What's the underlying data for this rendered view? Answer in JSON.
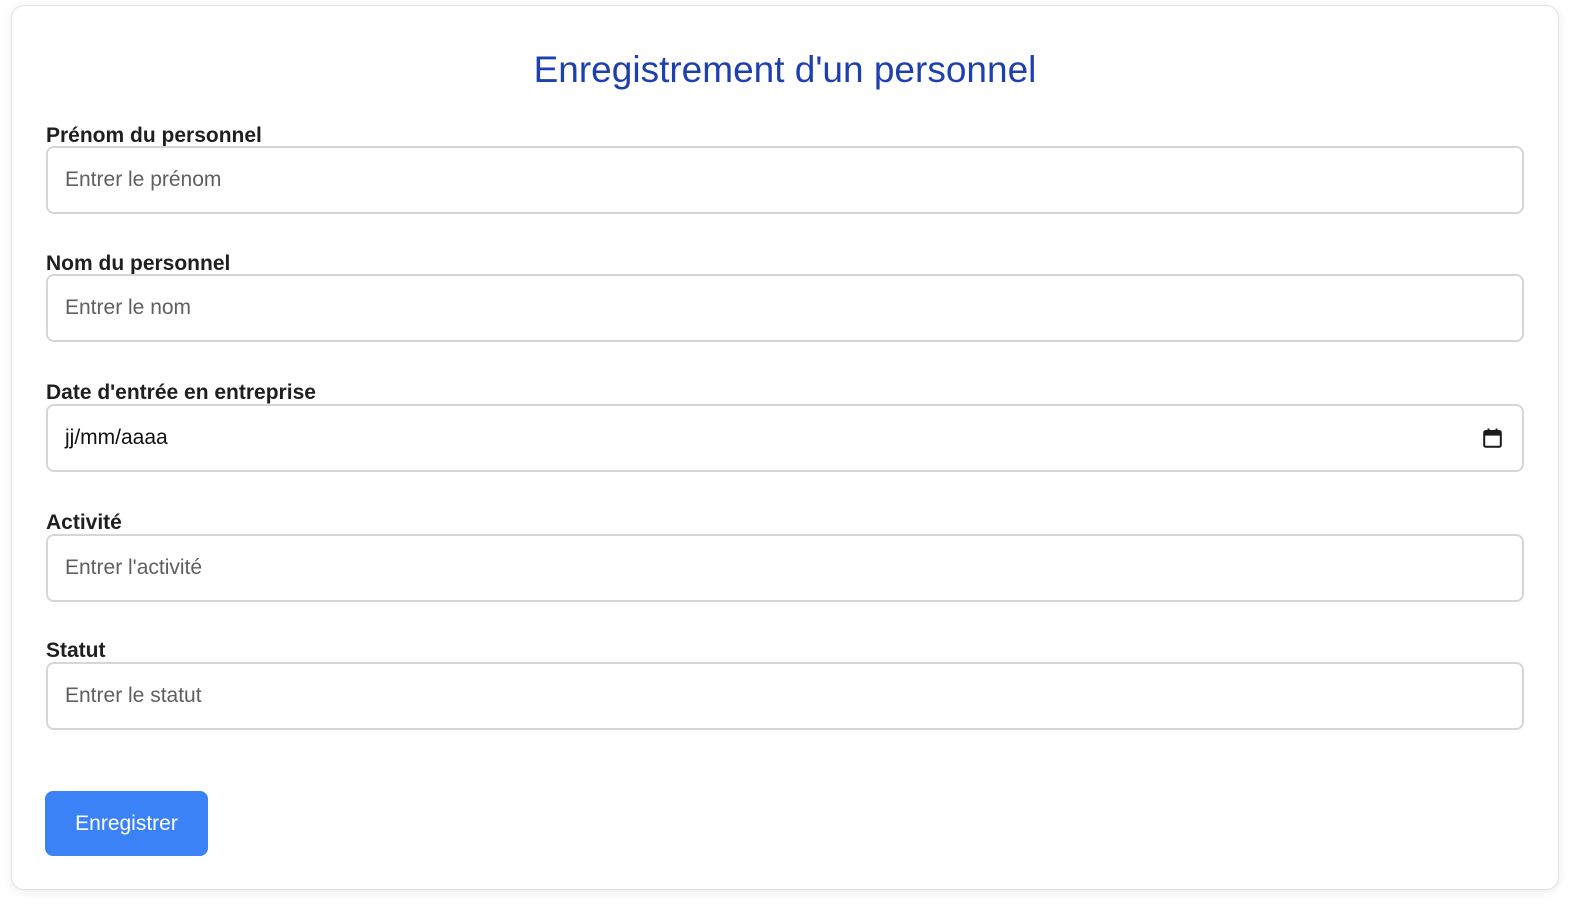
{
  "form": {
    "title": "Enregistrement d'un personnel",
    "fields": [
      {
        "label": "Prénom du personnel",
        "placeholder": "Entrer le prénom"
      },
      {
        "label": "Nom du personnel",
        "placeholder": "Entrer le nom"
      },
      {
        "label": "Date d'entrée en entreprise",
        "value": "jj/mm/aaaa",
        "icon": "calendar-icon"
      },
      {
        "label": "Activité",
        "placeholder": "Entrer l'activité"
      },
      {
        "label": "Statut",
        "placeholder": "Entrer le statut"
      }
    ],
    "submit_label": "Enregistrer"
  },
  "colors": {
    "title": "#1e40af",
    "button": "#3b82f6",
    "field_border": "#d6d6d6"
  }
}
